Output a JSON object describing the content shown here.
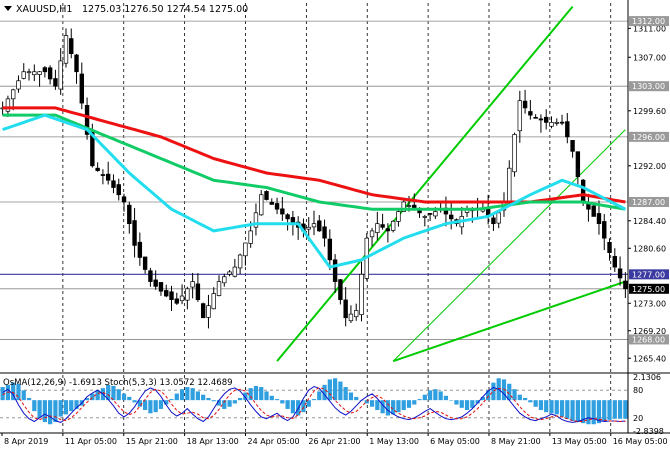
{
  "header": {
    "symbol_text": "XAUUSD,H1",
    "ohlc_text": "1275.03 1276.50 1274.54 1275.00"
  },
  "price_axis": {
    "ticks": [
      "1311.00",
      "1307.00",
      "1299.60",
      "1292.00",
      "1284.40",
      "1280.60",
      "1273.00",
      "1269.20",
      "1265.40"
    ],
    "boxed_labels": [
      "1312.00",
      "1303.00",
      "1296.00",
      "1287.00",
      "1277.00",
      "1275.00",
      "1268.00"
    ]
  },
  "oscillator": {
    "label_text": "OsMA(12,26,9) -1.6913  Stoch(5,3,3) 13.0572 12.4689",
    "axis_ticks": [
      "2.1306",
      "80",
      "20",
      "-2.8398"
    ]
  },
  "time_axis": {
    "labels": [
      "8 Apr 2019",
      "11 Apr 05:00",
      "15 Apr 21:00",
      "18 Apr 13:00",
      "24 Apr 05:00",
      "26 Apr 21:00",
      "1 May 13:00",
      "6 May 05:00",
      "8 May 21:00",
      "13 May 05:00",
      "16 May 05:00"
    ]
  },
  "chart_data": {
    "type": "line",
    "symbol": "XAUUSD",
    "timeframe": "H1",
    "last_bar": {
      "open": 1275.03,
      "high": 1276.5,
      "low": 1274.54,
      "close": 1275.0
    },
    "ylim": [
      1263.5,
      1314.5
    ],
    "x_labels": [
      "8 Apr 2019",
      "11 Apr 05:00",
      "15 Apr 21:00",
      "18 Apr 13:00",
      "24 Apr 05:00",
      "26 Apr 21:00",
      "1 May 13:00",
      "6 May 05:00",
      "8 May 21:00",
      "13 May 05:00",
      "16 May 05:00"
    ],
    "price_path": [
      [
        0,
        1300
      ],
      [
        4,
        1305
      ],
      [
        8,
        1305
      ],
      [
        10,
        1303
      ],
      [
        12,
        1310
      ],
      [
        14,
        1305
      ],
      [
        17,
        1292
      ],
      [
        20,
        1290
      ],
      [
        23,
        1287
      ],
      [
        25,
        1281
      ],
      [
        28,
        1276
      ],
      [
        31,
        1274
      ],
      [
        33,
        1273
      ],
      [
        36,
        1276
      ],
      [
        38,
        1271
      ],
      [
        41,
        1276
      ],
      [
        44,
        1278
      ],
      [
        47,
        1283
      ],
      [
        49,
        1288
      ],
      [
        52,
        1286
      ],
      [
        55,
        1284
      ],
      [
        57,
        1283
      ],
      [
        59,
        1284
      ],
      [
        61,
        1282
      ],
      [
        63,
        1276
      ],
      [
        65,
        1271
      ],
      [
        67,
        1272
      ],
      [
        69,
        1282
      ],
      [
        71,
        1284
      ],
      [
        73,
        1283
      ],
      [
        76,
        1287
      ],
      [
        80,
        1285
      ],
      [
        83,
        1286
      ],
      [
        86,
        1284
      ],
      [
        88,
        1286
      ],
      [
        91,
        1286
      ],
      [
        93,
        1284
      ],
      [
        95,
        1287
      ],
      [
        98,
        1301
      ],
      [
        100,
        1299
      ],
      [
        103,
        1298
      ],
      [
        106,
        1298
      ],
      [
        108,
        1294
      ],
      [
        110,
        1287
      ],
      [
        113,
        1284
      ],
      [
        116,
        1278
      ],
      [
        118,
        1275
      ]
    ],
    "series": [
      {
        "type": "line",
        "points": [
          [
            0,
            1300
          ],
          [
            10,
            1300
          ],
          [
            20,
            1298
          ],
          [
            30,
            1296
          ],
          [
            40,
            1293
          ],
          [
            50,
            1291
          ],
          [
            60,
            1290
          ],
          [
            70,
            1288
          ],
          [
            80,
            1287
          ],
          [
            90,
            1287
          ],
          [
            100,
            1287
          ],
          [
            110,
            1288
          ],
          [
            118,
            1287
          ]
        ]
      },
      {
        "type": "line",
        "points": [
          [
            0,
            1299
          ],
          [
            10,
            1299
          ],
          [
            20,
            1296
          ],
          [
            30,
            1293
          ],
          [
            40,
            1290
          ],
          [
            50,
            1289
          ],
          [
            60,
            1287
          ],
          [
            70,
            1286
          ],
          [
            80,
            1286
          ],
          [
            90,
            1286
          ],
          [
            100,
            1287
          ],
          [
            110,
            1287
          ],
          [
            118,
            1286
          ]
        ]
      },
      {
        "type": "line",
        "points": [
          [
            0,
            1297
          ],
          [
            8,
            1299
          ],
          [
            16,
            1297
          ],
          [
            24,
            1291
          ],
          [
            32,
            1286
          ],
          [
            40,
            1283
          ],
          [
            48,
            1284
          ],
          [
            56,
            1284
          ],
          [
            62,
            1278
          ],
          [
            68,
            1279
          ],
          [
            76,
            1282
          ],
          [
            84,
            1284
          ],
          [
            92,
            1285
          ],
          [
            100,
            1288
          ],
          [
            106,
            1290
          ],
          [
            110,
            1289
          ],
          [
            118,
            1286
          ]
        ]
      }
    ],
    "channel": {
      "upper": [
        [
          52,
          1265
        ],
        [
          108,
          1314
        ]
      ],
      "lower": [
        [
          74,
          1265
        ],
        [
          118,
          1276
        ]
      ],
      "middle": [
        [
          74,
          1265
        ],
        [
          118,
          1297
        ]
      ]
    },
    "horizontal_levels": [
      1312,
      1303,
      1296,
      1287,
      1277,
      1275,
      1268
    ],
    "oscillator": {
      "ylim": [
        -3,
        2.3
      ],
      "histogram": [
        1.2,
        1.4,
        1.6,
        1.5,
        0.9,
        0.2,
        -1.0,
        -1.6,
        -2.0,
        -2.2,
        -2.0,
        -1.5,
        -1.3,
        -1.0,
        -0.8,
        -0.5,
        0.2,
        0.6,
        0.9,
        1.1,
        1.4,
        1.3,
        1.0,
        0.6,
        0.3,
        -0.2,
        -0.6,
        -0.9,
        -1.2,
        -1.1,
        -0.8,
        -0.4,
        0.1,
        0.6,
        1.0,
        1.2,
        1.1,
        0.8,
        0.5,
        0.2,
        -0.1,
        -0.5,
        -0.8,
        -0.6,
        -0.3,
        0.2,
        0.7,
        1.1,
        1.3,
        1.2,
        0.8,
        0.4,
        0.1,
        -0.3,
        -0.8,
        -1.2,
        -1.4,
        -1.1,
        -0.6,
        0.1,
        0.8,
        1.4,
        1.9,
        2.0,
        1.7,
        1.2,
        0.7,
        0.3,
        0.0,
        -0.3,
        -0.6,
        -0.9,
        -1.2,
        -1.4,
        -1.3,
        -1.1,
        -0.9,
        -0.7,
        -0.4,
        0.1,
        0.5,
        0.9,
        1.0,
        0.8,
        0.4,
        0.0,
        -0.4,
        -0.7,
        -0.9,
        -0.7,
        -0.3,
        0.3,
        0.9,
        1.6,
        2.0,
        1.9,
        1.5,
        1.0,
        0.5,
        0.2,
        -0.2,
        -0.6,
        -0.9,
        -1.1,
        -1.2,
        -1.3,
        -1.5,
        -1.7,
        -1.9,
        -2.0,
        -2.1,
        -2.2,
        -2.2,
        -2.1,
        -1.9,
        -1.8,
        -1.7,
        -1.7,
        -1.7
      ],
      "stoch_main": [
        75,
        82,
        70,
        48,
        30,
        18,
        12,
        20,
        28,
        22,
        14,
        10,
        18,
        30,
        42,
        52,
        66,
        74,
        80,
        72,
        60,
        46,
        30,
        22,
        30,
        44,
        62,
        78,
        85,
        80,
        66,
        48,
        32,
        24,
        30,
        40,
        28,
        18,
        12,
        22,
        40,
        58,
        72,
        82,
        85,
        78,
        64,
        48,
        34,
        22,
        18,
        24,
        30,
        20,
        14,
        22,
        40,
        62,
        80,
        88,
        84,
        70,
        56,
        42,
        32,
        26,
        34,
        46,
        58,
        66,
        72,
        62,
        48,
        36,
        28,
        22,
        18,
        16,
        20,
        26,
        34,
        40,
        32,
        24,
        18,
        16,
        18,
        22,
        30,
        40,
        52,
        66,
        78,
        86,
        82,
        72,
        58,
        44,
        30,
        22,
        16,
        14,
        18,
        22,
        28,
        24,
        16,
        12,
        10,
        12,
        16,
        20,
        18,
        14,
        12,
        13,
        13,
        12,
        13
      ],
      "stoch_signal": [
        70,
        76,
        75,
        65,
        48,
        32,
        20,
        16,
        20,
        24,
        22,
        16,
        14,
        20,
        30,
        42,
        54,
        64,
        73,
        75,
        70,
        58,
        45,
        33,
        27,
        31,
        45,
        60,
        75,
        82,
        78,
        66,
        50,
        36,
        28,
        30,
        32,
        28,
        20,
        18,
        25,
        38,
        55,
        70,
        80,
        82,
        78,
        66,
        50,
        36,
        26,
        22,
        24,
        24,
        20,
        19,
        26,
        42,
        62,
        78,
        86,
        82,
        72,
        58,
        46,
        36,
        30,
        34,
        44,
        56,
        64,
        68,
        62,
        50,
        38,
        30,
        24,
        20,
        18,
        20,
        24,
        30,
        34,
        32,
        26,
        20,
        18,
        18,
        22,
        30,
        40,
        52,
        66,
        78,
        84,
        82,
        72,
        58,
        44,
        32,
        22,
        18,
        16,
        18,
        22,
        24,
        22,
        18,
        14,
        12,
        12,
        16,
        18,
        17,
        15,
        13,
        13,
        12,
        12.5
      ]
    }
  }
}
